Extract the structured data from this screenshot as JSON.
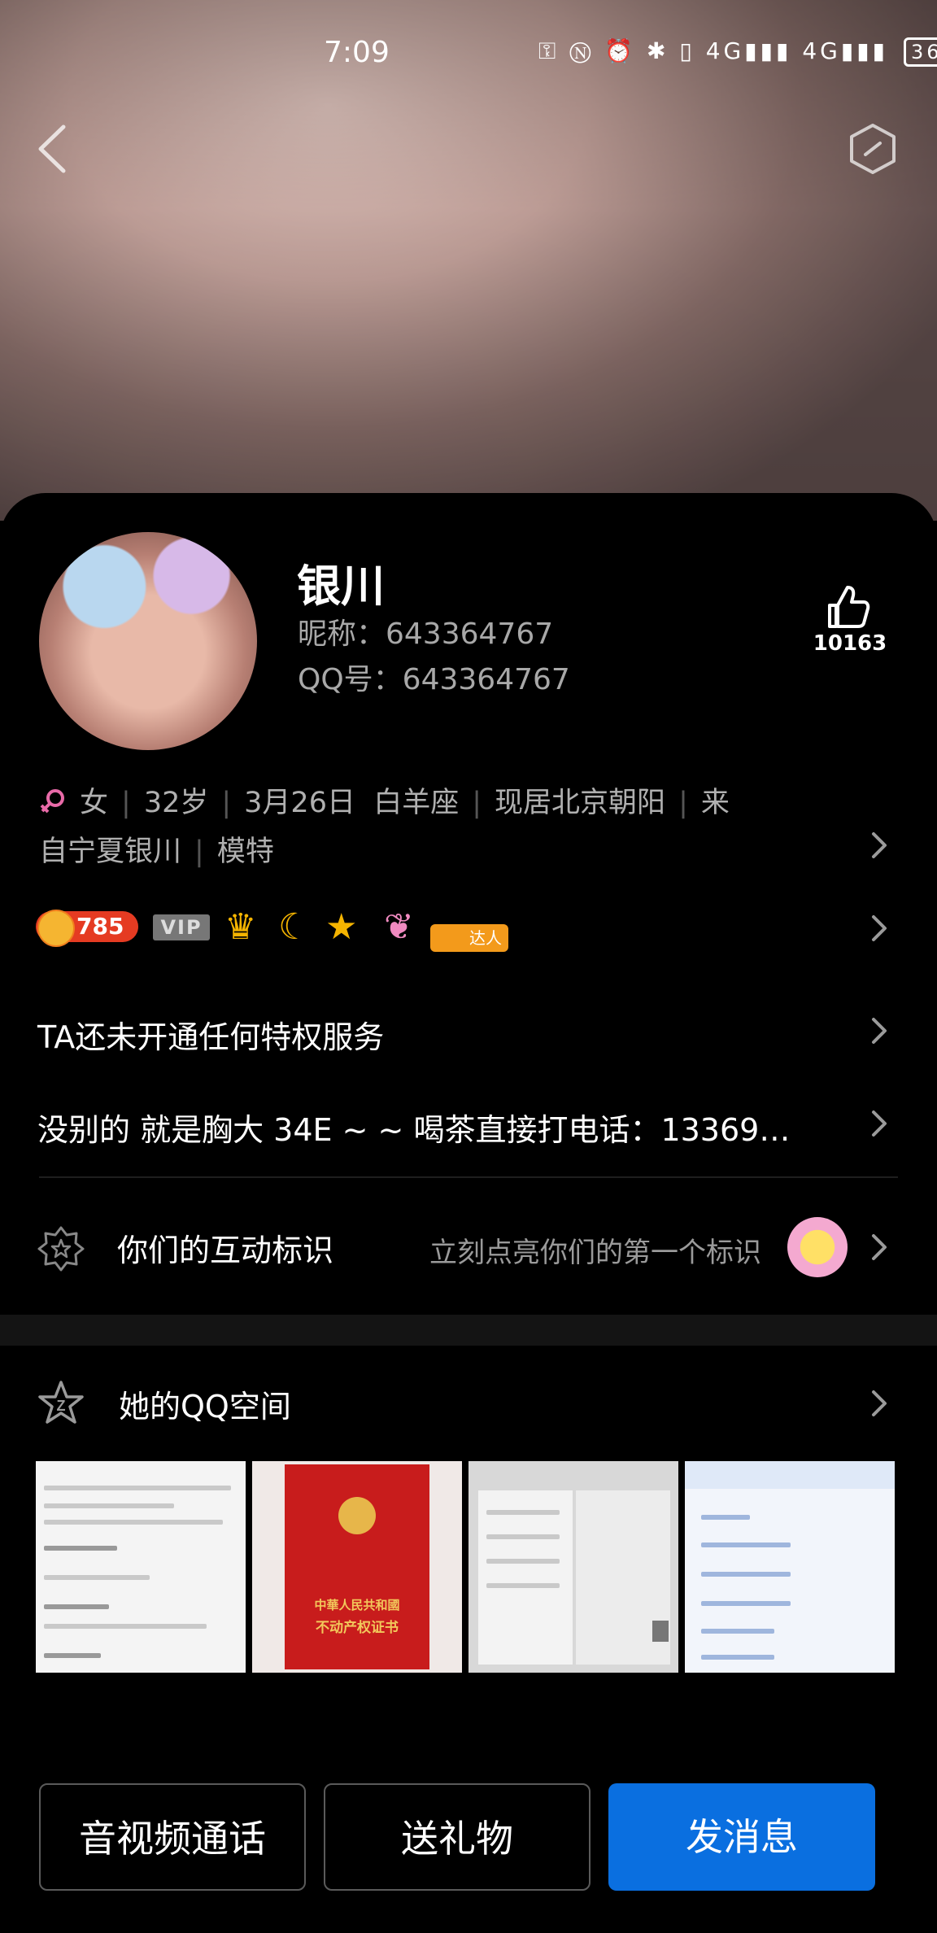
{
  "status_bar": {
    "time": "7:09",
    "battery": "36",
    "icons": "⚿ Ⓝ ⏰ ✱ ▯ 4G▮▮▮ 4G▮▮▮"
  },
  "profile": {
    "name": "银川",
    "nickname": "昵称：643364767",
    "qq": "QQ号：643364767",
    "likes": "10163"
  },
  "info": {
    "gender": "女",
    "age": "32岁",
    "birthday": "3月26日",
    "zodiac": "白羊座",
    "residence": "现居北京朝阳",
    "from_prefix": "来",
    "from_rest": "自宁夏银川",
    "job": "模特"
  },
  "badges": {
    "coin_value": "785",
    "vip_label": "VIP",
    "daren_label": "达人"
  },
  "privilege_text": "TA还未开通任何特权服务",
  "signature": "没别的 就是胸大 34E ~ ~ 喝茶直接打电话：13369…",
  "interaction": {
    "title": "你们的互动标识",
    "hint": "立刻点亮你们的第一个标识"
  },
  "qzone": {
    "title": "她的QQ空间",
    "photo2_line1": "中華人民共和國",
    "photo2_line2": "不动产权证书"
  },
  "actions": {
    "call": "音视频通话",
    "gift": "送礼物",
    "message": "发消息"
  },
  "colors": {
    "primary_button": "#0a6fe0",
    "coin": "#e53b22",
    "gender_icon": "#e86aa8"
  }
}
